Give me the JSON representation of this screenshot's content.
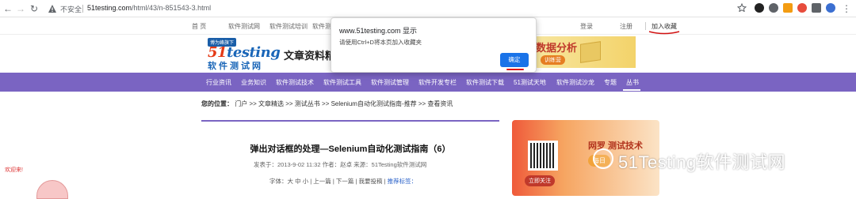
{
  "browser": {
    "not_secure": "不安全",
    "url_domain": "51testing.com",
    "url_path": "/html/43/n-851543-3.html"
  },
  "topnav": {
    "home": "首 页",
    "items": [
      "软件测试网",
      "软件测试培训",
      "软件测"
    ],
    "login": "登录",
    "register": "注册",
    "favorite": "加入收藏"
  },
  "logo": {
    "tag": "博为峰旗下",
    "brand_num": "51",
    "brand_text": "testing",
    "sub": "软件测试网"
  },
  "banner": {
    "title": "文章资料精",
    "ad_title": "数据分析",
    "ad_pill": "训练营"
  },
  "mainnav": {
    "items": [
      "行业资讯",
      "业务知识",
      "软件测试技术",
      "软件测试工具",
      "软件测试管理",
      "软件开发专栏",
      "软件测试下载",
      "51测试天地",
      "软件测试沙龙",
      "专题",
      "丛书"
    ]
  },
  "breadcrumb": {
    "label": "您的位置：",
    "path": "门户 >> 文章精选 >> 测试丛书 >> Selenium自动化测试指南-推荐 >> 查看资讯"
  },
  "article": {
    "title": "弹出对话框的处理—Selenium自动化测试指南（6）",
    "meta": "发表于：2013-9-02 11:32  作者：赵卓   来源：51Testing软件测试网",
    "tools_prefix": "字体：大 中 小 | 上一篇 | 下一篇 | 我要投稿 | ",
    "tools_link": "推荐标签："
  },
  "right_ad": {
    "title": "网罗    测试技术",
    "sub": "每日",
    "cta": "立即关注"
  },
  "floater": {
    "text": "欢迎来!"
  },
  "dialog": {
    "title": "www.51testing.com 显示",
    "message": "请使用Ctrl+D将本页加入收藏夹",
    "ok": "确定"
  },
  "watermark": {
    "text": "51Testing软件测试网"
  },
  "colors": {
    "nav_purple": "#7a64c2",
    "dialog_button": "#1a73e8",
    "annotation_red": "#d11111"
  }
}
